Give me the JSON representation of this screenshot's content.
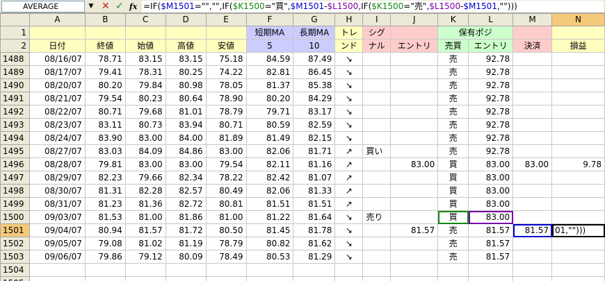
{
  "formula_bar": {
    "name_box": "AVERAGE",
    "formula_parts": [
      {
        "t": "=IF(",
        "c": ""
      },
      {
        "t": "$M1501",
        "c": "ref-blue"
      },
      {
        "t": "=\"\",\"\",IF(",
        "c": ""
      },
      {
        "t": "$K1500",
        "c": "ref-green"
      },
      {
        "t": "=\"買\",",
        "c": ""
      },
      {
        "t": "$M1501",
        "c": "ref-blue"
      },
      {
        "t": "-",
        "c": ""
      },
      {
        "t": "$L1500",
        "c": "ref-purple"
      },
      {
        "t": ",IF(",
        "c": ""
      },
      {
        "t": "$K1500",
        "c": "ref-green"
      },
      {
        "t": "=\"売\",",
        "c": ""
      },
      {
        "t": "$L1500",
        "c": "ref-purple"
      },
      {
        "t": "-",
        "c": ""
      },
      {
        "t": "$M1501",
        "c": "ref-blue"
      },
      {
        "t": ",\"\")))",
        "c": ""
      }
    ]
  },
  "columns": [
    "",
    "A",
    "B",
    "C",
    "D",
    "E",
    "F",
    "G",
    "H",
    "I",
    "J",
    "K",
    "L",
    "M",
    "N"
  ],
  "header_row1": {
    "row_num": "1",
    "F": "短期MA",
    "G": "長期MA",
    "H": "トレ",
    "I": "シグ",
    "KL": "保有ポジ"
  },
  "header_row2": {
    "row_num": "2",
    "A": "日付",
    "B": "終値",
    "C": "始値",
    "D": "高値",
    "E": "安値",
    "F": "5",
    "G": "10",
    "H": "ンド",
    "I": "ナル",
    "J": "エントリ",
    "K": "売買",
    "L": "エントリ",
    "M": "決済",
    "N": "損益"
  },
  "rows": [
    {
      "n": "1488",
      "A": "08/16/07",
      "B": "78.71",
      "C": "83.15",
      "D": "83.15",
      "E": "75.18",
      "F": "84.59",
      "G": "87.49",
      "H": "↘",
      "I": "",
      "J": "",
      "K": "売",
      "L": "92.78",
      "M": "",
      "N": ""
    },
    {
      "n": "1489",
      "A": "08/17/07",
      "B": "79.41",
      "C": "78.31",
      "D": "80.25",
      "E": "74.22",
      "F": "82.81",
      "G": "86.45",
      "H": "↘",
      "I": "",
      "J": "",
      "K": "売",
      "L": "92.78",
      "M": "",
      "N": ""
    },
    {
      "n": "1490",
      "A": "08/20/07",
      "B": "80.20",
      "C": "79.84",
      "D": "80.98",
      "E": "78.05",
      "F": "81.37",
      "G": "85.38",
      "H": "↘",
      "I": "",
      "J": "",
      "K": "売",
      "L": "92.78",
      "M": "",
      "N": ""
    },
    {
      "n": "1491",
      "A": "08/21/07",
      "B": "79.54",
      "C": "80.23",
      "D": "80.64",
      "E": "78.90",
      "F": "80.20",
      "G": "84.29",
      "H": "↘",
      "I": "",
      "J": "",
      "K": "売",
      "L": "92.78",
      "M": "",
      "N": ""
    },
    {
      "n": "1492",
      "A": "08/22/07",
      "B": "80.71",
      "C": "79.68",
      "D": "81.01",
      "E": "78.79",
      "F": "79.71",
      "G": "83.17",
      "H": "↘",
      "I": "",
      "J": "",
      "K": "売",
      "L": "92.78",
      "M": "",
      "N": ""
    },
    {
      "n": "1493",
      "A": "08/23/07",
      "B": "83.11",
      "C": "80.73",
      "D": "83.94",
      "E": "80.71",
      "F": "80.59",
      "G": "82.59",
      "H": "↘",
      "I": "",
      "J": "",
      "K": "売",
      "L": "92.78",
      "M": "",
      "N": ""
    },
    {
      "n": "1494",
      "A": "08/24/07",
      "B": "83.90",
      "C": "83.00",
      "D": "84.00",
      "E": "81.89",
      "F": "81.49",
      "G": "82.15",
      "H": "↘",
      "I": "",
      "J": "",
      "K": "売",
      "L": "92.78",
      "M": "",
      "N": ""
    },
    {
      "n": "1495",
      "A": "08/27/07",
      "B": "83.03",
      "C": "84.09",
      "D": "84.86",
      "E": "83.00",
      "F": "82.06",
      "G": "81.71",
      "H": "↗",
      "I": "買い",
      "J": "",
      "K": "売",
      "L": "92.78",
      "M": "",
      "N": ""
    },
    {
      "n": "1496",
      "A": "08/28/07",
      "B": "79.81",
      "C": "83.00",
      "D": "83.00",
      "E": "79.54",
      "F": "82.11",
      "G": "81.16",
      "H": "↗",
      "I": "",
      "J": "83.00",
      "K": "買",
      "L": "83.00",
      "M": "83.00",
      "N": "9.78"
    },
    {
      "n": "1497",
      "A": "08/29/07",
      "B": "82.23",
      "C": "79.66",
      "D": "82.34",
      "E": "78.22",
      "F": "82.42",
      "G": "81.07",
      "H": "↗",
      "I": "",
      "J": "",
      "K": "買",
      "L": "83.00",
      "M": "",
      "N": ""
    },
    {
      "n": "1498",
      "A": "08/30/07",
      "B": "81.31",
      "C": "82.28",
      "D": "82.57",
      "E": "80.49",
      "F": "82.06",
      "G": "81.33",
      "H": "↗",
      "I": "",
      "J": "",
      "K": "買",
      "L": "83.00",
      "M": "",
      "N": ""
    },
    {
      "n": "1499",
      "A": "08/31/07",
      "B": "81.23",
      "C": "81.36",
      "D": "82.72",
      "E": "80.81",
      "F": "81.51",
      "G": "81.51",
      "H": "↗",
      "I": "",
      "J": "",
      "K": "買",
      "L": "83.00",
      "M": "",
      "N": ""
    },
    {
      "n": "1500",
      "A": "09/03/07",
      "B": "81.53",
      "C": "81.00",
      "D": "81.86",
      "E": "81.00",
      "F": "81.22",
      "G": "81.64",
      "H": "↘",
      "I": "売り",
      "J": "",
      "K": "買",
      "L": "83.00",
      "M": "",
      "N": ""
    },
    {
      "n": "1501",
      "A": "09/04/07",
      "B": "80.94",
      "C": "81.57",
      "D": "81.72",
      "E": "80.50",
      "F": "81.45",
      "G": "81.78",
      "H": "↘",
      "I": "",
      "J": "81.57",
      "K": "売",
      "L": "81.57",
      "M": "81.57",
      "N": "01,\"\")))"
    },
    {
      "n": "1502",
      "A": "09/05/07",
      "B": "79.08",
      "C": "81.02",
      "D": "81.19",
      "E": "78.79",
      "F": "80.82",
      "G": "81.62",
      "H": "↘",
      "I": "",
      "J": "",
      "K": "売",
      "L": "81.57",
      "M": "",
      "N": ""
    },
    {
      "n": "1503",
      "A": "09/06/07",
      "B": "79.86",
      "C": "79.12",
      "D": "80.09",
      "E": "78.49",
      "F": "80.53",
      "G": "81.29",
      "H": "↘",
      "I": "",
      "J": "",
      "K": "売",
      "L": "81.57",
      "M": "",
      "N": ""
    },
    {
      "n": "1504",
      "A": "",
      "B": "",
      "C": "",
      "D": "",
      "E": "",
      "F": "",
      "G": "",
      "H": "",
      "I": "",
      "J": "",
      "K": "",
      "L": "",
      "M": "",
      "N": ""
    },
    {
      "n": "1505",
      "A": "",
      "B": "",
      "C": "",
      "D": "",
      "E": "",
      "F": "",
      "G": "",
      "H": "",
      "I": "",
      "J": "",
      "K": "",
      "L": "",
      "M": "",
      "N": ""
    }
  ]
}
